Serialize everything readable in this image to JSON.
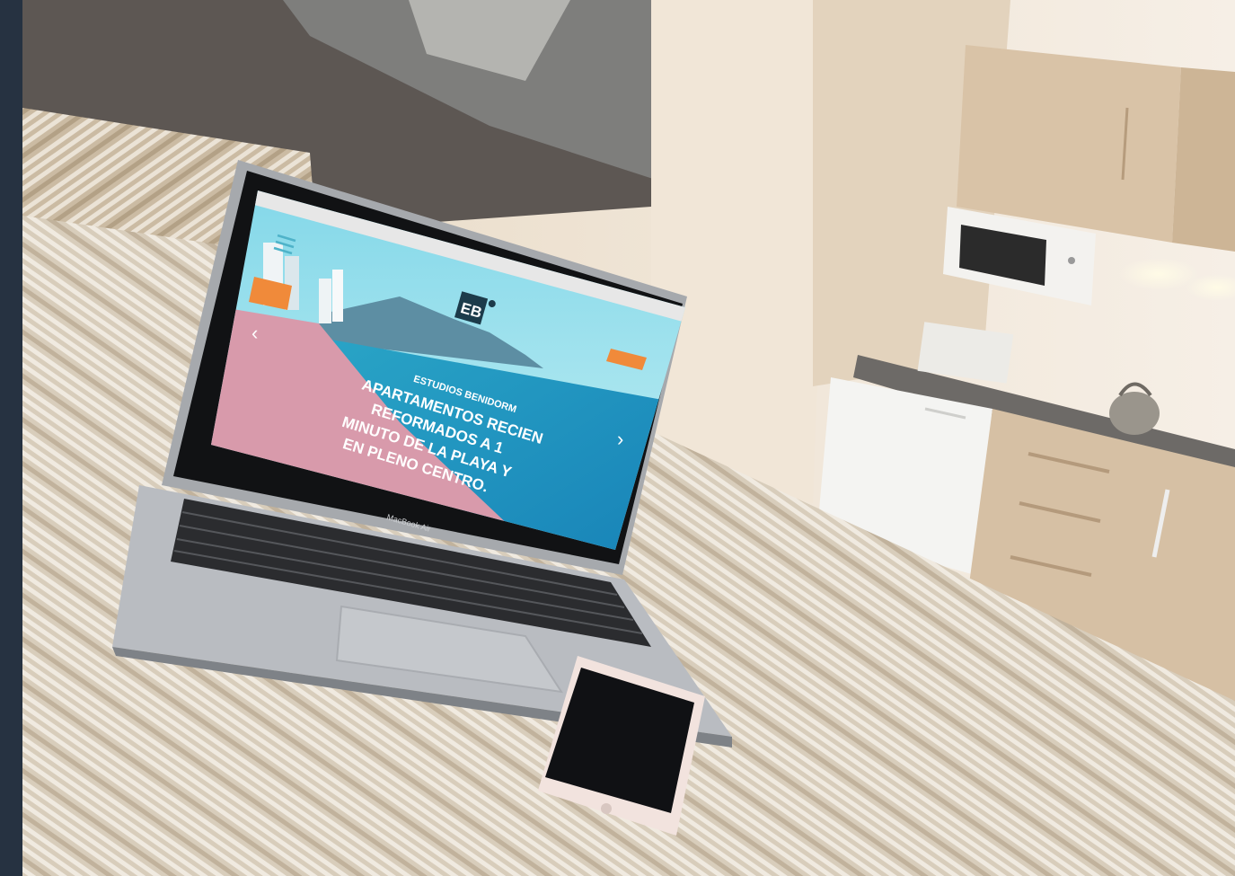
{
  "laptop": {
    "brand_label": "MacBook Air"
  },
  "website": {
    "logo_text": "EB",
    "kicker": "ESTUDIOS BENIDORM",
    "headline_lines": [
      "APARTAMENTOS RECIEN",
      "REFORMADOS A 1",
      "MINUTO DE LA PLAYA Y",
      "EN PLENO CENTRO."
    ],
    "nav_prev": "‹",
    "nav_next": "›"
  },
  "colors": {
    "frame": "#263241",
    "wall": "#e9e0d2",
    "bedspread": "#c9b9a0",
    "sea": "#39c3d6",
    "sand": "#d79aa8",
    "accent_orange": "#f08a3a"
  }
}
